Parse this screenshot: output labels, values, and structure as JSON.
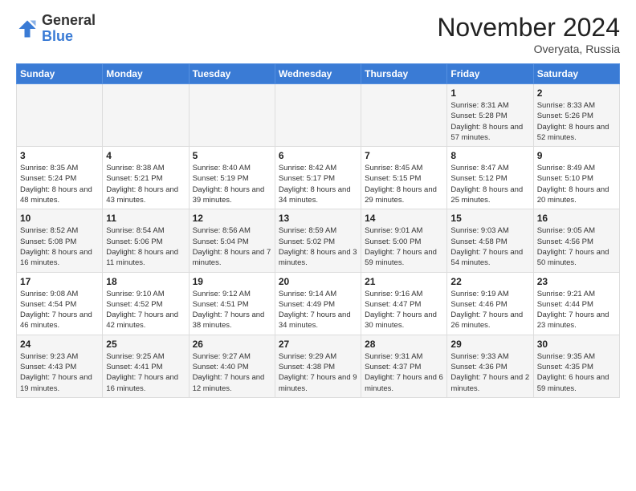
{
  "logo": {
    "general": "General",
    "blue": "Blue"
  },
  "header": {
    "month": "November 2024",
    "location": "Overyata, Russia"
  },
  "days_of_week": [
    "Sunday",
    "Monday",
    "Tuesday",
    "Wednesday",
    "Thursday",
    "Friday",
    "Saturday"
  ],
  "weeks": [
    [
      {
        "day": "",
        "sunrise": "",
        "sunset": "",
        "daylight": ""
      },
      {
        "day": "",
        "sunrise": "",
        "sunset": "",
        "daylight": ""
      },
      {
        "day": "",
        "sunrise": "",
        "sunset": "",
        "daylight": ""
      },
      {
        "day": "",
        "sunrise": "",
        "sunset": "",
        "daylight": ""
      },
      {
        "day": "",
        "sunrise": "",
        "sunset": "",
        "daylight": ""
      },
      {
        "day": "1",
        "sunrise": "Sunrise: 8:31 AM",
        "sunset": "Sunset: 5:28 PM",
        "daylight": "Daylight: 8 hours and 57 minutes."
      },
      {
        "day": "2",
        "sunrise": "Sunrise: 8:33 AM",
        "sunset": "Sunset: 5:26 PM",
        "daylight": "Daylight: 8 hours and 52 minutes."
      }
    ],
    [
      {
        "day": "3",
        "sunrise": "Sunrise: 8:35 AM",
        "sunset": "Sunset: 5:24 PM",
        "daylight": "Daylight: 8 hours and 48 minutes."
      },
      {
        "day": "4",
        "sunrise": "Sunrise: 8:38 AM",
        "sunset": "Sunset: 5:21 PM",
        "daylight": "Daylight: 8 hours and 43 minutes."
      },
      {
        "day": "5",
        "sunrise": "Sunrise: 8:40 AM",
        "sunset": "Sunset: 5:19 PM",
        "daylight": "Daylight: 8 hours and 39 minutes."
      },
      {
        "day": "6",
        "sunrise": "Sunrise: 8:42 AM",
        "sunset": "Sunset: 5:17 PM",
        "daylight": "Daylight: 8 hours and 34 minutes."
      },
      {
        "day": "7",
        "sunrise": "Sunrise: 8:45 AM",
        "sunset": "Sunset: 5:15 PM",
        "daylight": "Daylight: 8 hours and 29 minutes."
      },
      {
        "day": "8",
        "sunrise": "Sunrise: 8:47 AM",
        "sunset": "Sunset: 5:12 PM",
        "daylight": "Daylight: 8 hours and 25 minutes."
      },
      {
        "day": "9",
        "sunrise": "Sunrise: 8:49 AM",
        "sunset": "Sunset: 5:10 PM",
        "daylight": "Daylight: 8 hours and 20 minutes."
      }
    ],
    [
      {
        "day": "10",
        "sunrise": "Sunrise: 8:52 AM",
        "sunset": "Sunset: 5:08 PM",
        "daylight": "Daylight: 8 hours and 16 minutes."
      },
      {
        "day": "11",
        "sunrise": "Sunrise: 8:54 AM",
        "sunset": "Sunset: 5:06 PM",
        "daylight": "Daylight: 8 hours and 11 minutes."
      },
      {
        "day": "12",
        "sunrise": "Sunrise: 8:56 AM",
        "sunset": "Sunset: 5:04 PM",
        "daylight": "Daylight: 8 hours and 7 minutes."
      },
      {
        "day": "13",
        "sunrise": "Sunrise: 8:59 AM",
        "sunset": "Sunset: 5:02 PM",
        "daylight": "Daylight: 8 hours and 3 minutes."
      },
      {
        "day": "14",
        "sunrise": "Sunrise: 9:01 AM",
        "sunset": "Sunset: 5:00 PM",
        "daylight": "Daylight: 7 hours and 59 minutes."
      },
      {
        "day": "15",
        "sunrise": "Sunrise: 9:03 AM",
        "sunset": "Sunset: 4:58 PM",
        "daylight": "Daylight: 7 hours and 54 minutes."
      },
      {
        "day": "16",
        "sunrise": "Sunrise: 9:05 AM",
        "sunset": "Sunset: 4:56 PM",
        "daylight": "Daylight: 7 hours and 50 minutes."
      }
    ],
    [
      {
        "day": "17",
        "sunrise": "Sunrise: 9:08 AM",
        "sunset": "Sunset: 4:54 PM",
        "daylight": "Daylight: 7 hours and 46 minutes."
      },
      {
        "day": "18",
        "sunrise": "Sunrise: 9:10 AM",
        "sunset": "Sunset: 4:52 PM",
        "daylight": "Daylight: 7 hours and 42 minutes."
      },
      {
        "day": "19",
        "sunrise": "Sunrise: 9:12 AM",
        "sunset": "Sunset: 4:51 PM",
        "daylight": "Daylight: 7 hours and 38 minutes."
      },
      {
        "day": "20",
        "sunrise": "Sunrise: 9:14 AM",
        "sunset": "Sunset: 4:49 PM",
        "daylight": "Daylight: 7 hours and 34 minutes."
      },
      {
        "day": "21",
        "sunrise": "Sunrise: 9:16 AM",
        "sunset": "Sunset: 4:47 PM",
        "daylight": "Daylight: 7 hours and 30 minutes."
      },
      {
        "day": "22",
        "sunrise": "Sunrise: 9:19 AM",
        "sunset": "Sunset: 4:46 PM",
        "daylight": "Daylight: 7 hours and 26 minutes."
      },
      {
        "day": "23",
        "sunrise": "Sunrise: 9:21 AM",
        "sunset": "Sunset: 4:44 PM",
        "daylight": "Daylight: 7 hours and 23 minutes."
      }
    ],
    [
      {
        "day": "24",
        "sunrise": "Sunrise: 9:23 AM",
        "sunset": "Sunset: 4:43 PM",
        "daylight": "Daylight: 7 hours and 19 minutes."
      },
      {
        "day": "25",
        "sunrise": "Sunrise: 9:25 AM",
        "sunset": "Sunset: 4:41 PM",
        "daylight": "Daylight: 7 hours and 16 minutes."
      },
      {
        "day": "26",
        "sunrise": "Sunrise: 9:27 AM",
        "sunset": "Sunset: 4:40 PM",
        "daylight": "Daylight: 7 hours and 12 minutes."
      },
      {
        "day": "27",
        "sunrise": "Sunrise: 9:29 AM",
        "sunset": "Sunset: 4:38 PM",
        "daylight": "Daylight: 7 hours and 9 minutes."
      },
      {
        "day": "28",
        "sunrise": "Sunrise: 9:31 AM",
        "sunset": "Sunset: 4:37 PM",
        "daylight": "Daylight: 7 hours and 6 minutes."
      },
      {
        "day": "29",
        "sunrise": "Sunrise: 9:33 AM",
        "sunset": "Sunset: 4:36 PM",
        "daylight": "Daylight: 7 hours and 2 minutes."
      },
      {
        "day": "30",
        "sunrise": "Sunrise: 9:35 AM",
        "sunset": "Sunset: 4:35 PM",
        "daylight": "Daylight: 6 hours and 59 minutes."
      }
    ]
  ]
}
